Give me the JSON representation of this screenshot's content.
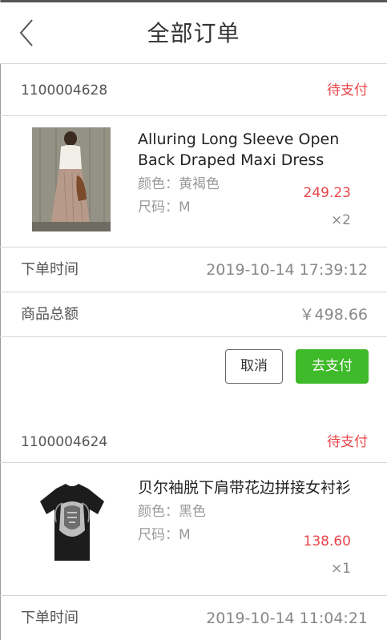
{
  "header": {
    "title": "全部订单"
  },
  "orders": [
    {
      "id": "1100004628",
      "status": "待支付",
      "item": {
        "name_line1": "Alluring Long Sleeve Open",
        "name_line2": "Back Draped Maxi Dress",
        "color": "颜色：黄褐色",
        "size": "尺码：M",
        "price": "249.23",
        "qty": "×2"
      },
      "time_label": "下单时间",
      "time_value": "2019-10-14 17:39:12",
      "total_label": "商品总额",
      "total_value": "￥498.66",
      "cancel_label": "取消",
      "pay_label": "去支付"
    },
    {
      "id": "1100004624",
      "status": "待支付",
      "item": {
        "name_line1": "贝尔袖脱下肩带花边拼接女衬衫",
        "color": "颜色：黑色",
        "size": "尺码：M",
        "price": "138.60",
        "qty": "×1"
      },
      "time_label": "下单时间",
      "time_value": "2019-10-14 11:04:21"
    }
  ]
}
